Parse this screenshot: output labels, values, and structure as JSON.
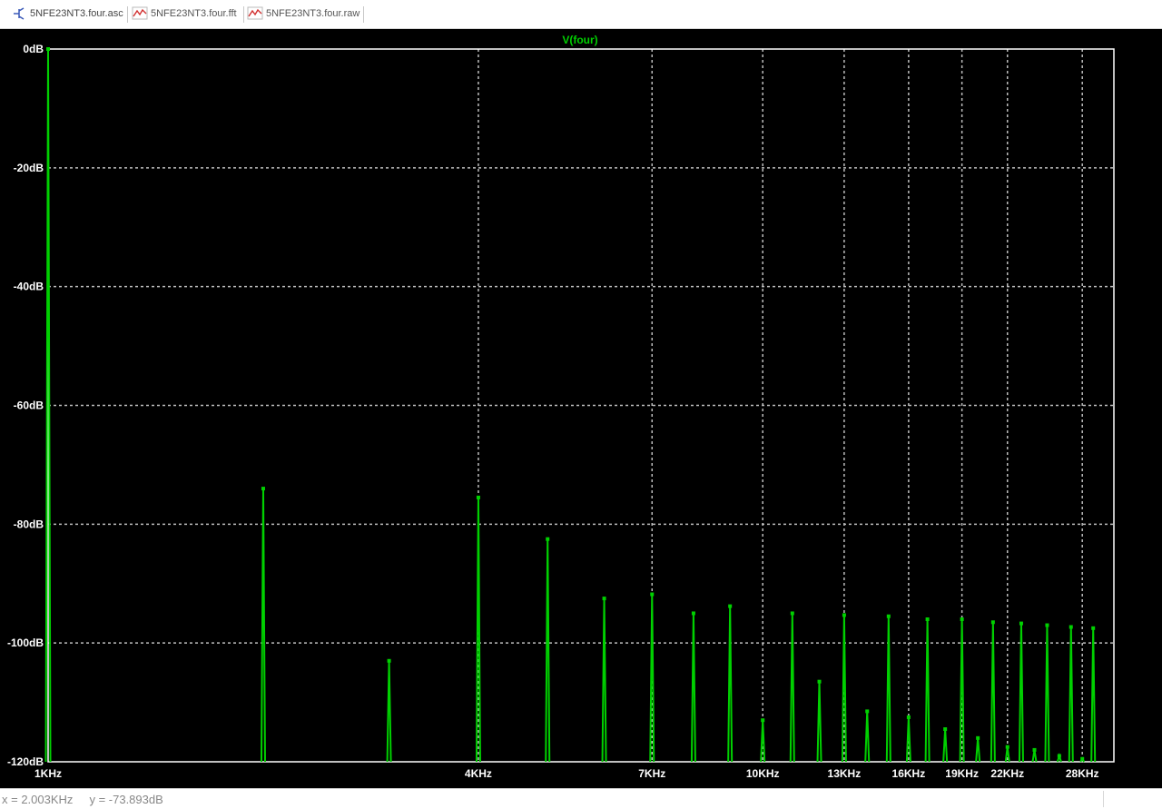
{
  "tabs": [
    {
      "label": "5NFE23NT3.four.asc",
      "icon": "schematic-icon"
    },
    {
      "label": "5NFE23NT3.four.fft",
      "icon": "waveform-icon"
    },
    {
      "label": "5NFE23NT3.four.raw",
      "icon": "waveform-icon"
    }
  ],
  "status": {
    "x_readout": "x = 2.003KHz",
    "y_readout": "y = -73.893dB"
  },
  "colors": {
    "trace": "#00d000",
    "background": "#000000",
    "grid": "#bdbdbd",
    "axis_text": "#ffffff",
    "title": "#00d000"
  },
  "chart_data": {
    "type": "line",
    "title": "V(four)",
    "xlabel": "",
    "ylabel": "",
    "x_scale": "log",
    "xlim": [
      1000,
      31000
    ],
    "ylim": [
      -120,
      0
    ],
    "grid": true,
    "xticks": [
      1000,
      4000,
      7000,
      10000,
      13000,
      16000,
      19000,
      22000,
      28000
    ],
    "xtick_labels": [
      "1KHz",
      "4KHz",
      "7KHz",
      "10KHz",
      "13KHz",
      "16KHz",
      "19KHz",
      "22KHz",
      "28KHz"
    ],
    "yticks": [
      0,
      -20,
      -40,
      -60,
      -80,
      -100,
      -120
    ],
    "ytick_labels": [
      "0dB",
      "-20dB",
      "-40dB",
      "-60dB",
      "-80dB",
      "-100dB",
      "-120dB"
    ],
    "series": [
      {
        "name": "V(four)",
        "color": "#00d000",
        "points": [
          [
            1000,
            0.0
          ],
          [
            2000,
            -74.0
          ],
          [
            3000,
            -103.0
          ],
          [
            4000,
            -75.5
          ],
          [
            5000,
            -82.5
          ],
          [
            6000,
            -92.5
          ],
          [
            7000,
            -91.8
          ],
          [
            8000,
            -95.0
          ],
          [
            9000,
            -93.8
          ],
          [
            10000,
            -113.0
          ],
          [
            11000,
            -95.0
          ],
          [
            12000,
            -106.5
          ],
          [
            13000,
            -95.3
          ],
          [
            14000,
            -111.5
          ],
          [
            15000,
            -95.5
          ],
          [
            16000,
            -112.5
          ],
          [
            17000,
            -96.0
          ],
          [
            18000,
            -114.5
          ],
          [
            19000,
            -96.0
          ],
          [
            20000,
            -116.0
          ],
          [
            21000,
            -96.5
          ],
          [
            22000,
            -117.5
          ],
          [
            23000,
            -96.7
          ],
          [
            24000,
            -118.0
          ],
          [
            25000,
            -97.0
          ],
          [
            26000,
            -119.0
          ],
          [
            27000,
            -97.3
          ],
          [
            28000,
            -119.5
          ],
          [
            29000,
            -97.5
          ]
        ]
      }
    ]
  }
}
